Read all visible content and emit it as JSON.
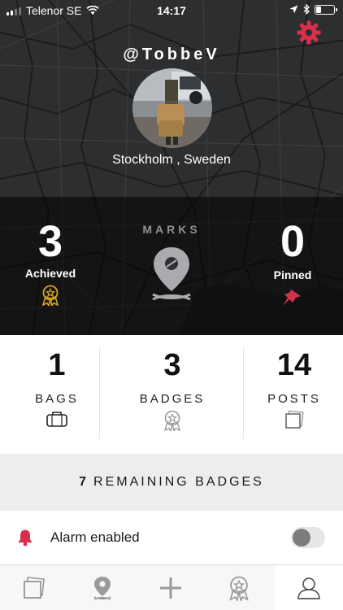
{
  "status_bar": {
    "carrier": "Telenor SE",
    "time": "14:17",
    "battery_level": 0.25
  },
  "profile": {
    "username": "@TobbeV",
    "location": "Stockholm , Sweden"
  },
  "marks": {
    "label": "MARKS",
    "achieved_count": "3",
    "achieved_label": "Achieved",
    "pinned_count": "0",
    "pinned_label": "Pinned"
  },
  "stats": [
    {
      "value": "1",
      "label": "BAGS",
      "icon": "bag-icon"
    },
    {
      "value": "3",
      "label": "BADGES",
      "icon": "badge-icon"
    },
    {
      "value": "14",
      "label": "POSTS",
      "icon": "posts-icon"
    }
  ],
  "remaining_badges": {
    "count": "7",
    "label": "REMAINING BADGES"
  },
  "alarm": {
    "label": "Alarm enabled",
    "enabled": false
  },
  "tabbar": {
    "items": [
      "posts-tab-icon",
      "map-pin-tab-icon",
      "add-tab-icon",
      "badge-tab-icon",
      "profile-tab-icon"
    ],
    "active_index": 4
  },
  "colors": {
    "accent_red": "#d8304a",
    "gold": "#d9a520",
    "map_bg": "#2b2c2e"
  }
}
